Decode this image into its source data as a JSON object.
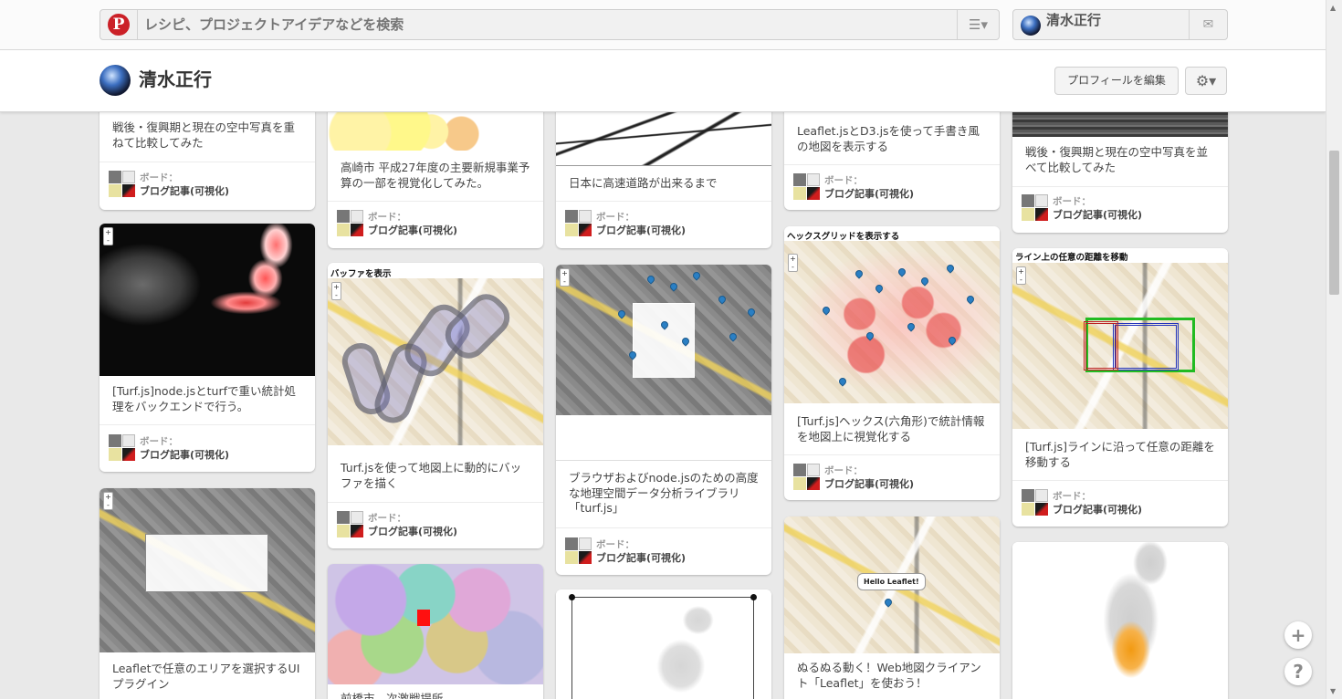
{
  "search": {
    "placeholder": "レシピ、プロジェクトアイデアなどを検索"
  },
  "user": {
    "name": "清水正行"
  },
  "profile": {
    "name": "清水正行",
    "edit_label": "プロフィールを編集"
  },
  "board": {
    "label": "ボード：",
    "name": "ブログ記事(可視化)"
  },
  "pins": {
    "c1p1": {
      "desc": "戦後・復興期と現在の空中写真を重ねて比較してみた"
    },
    "c1p2": {
      "desc": "[Turf.js]node.jsとturfで重い統計処理をバックエンドで行う。"
    },
    "c1p3": {
      "desc": "Leafletで任意のエリアを選択するUIプラグイン"
    },
    "c2p1": {
      "desc": "高崎市 平成27年度の主要新規事業予算の一部を視覚化してみた。"
    },
    "c2p2": {
      "label": "バッファを表示",
      "desc": "Turf.jsを使って地図上に動的にバッファを描く"
    },
    "c2p3": {
      "desc": "前橋市　次激戦提所"
    },
    "c3p1": {
      "desc": "日本に高速道路が出来るまで"
    },
    "c3p2": {
      "desc": "ブラウザおよびnode.jsのための高度な地理空間データ分析ライブラリ「turf.js」"
    },
    "c4p1": {
      "desc": "Leaflet.jsとD3.jsを使って手書き風の地図を表示する"
    },
    "c4p2": {
      "label": "ヘックスグリッドを表示する",
      "desc": "[Turf.js]ヘックス(六角形)で統計情報を地図上に視覚化する"
    },
    "c4p3": {
      "desc": "ぬるぬる動く！Web地図クライアント「Leaflet」を使おう！",
      "popup": "Hello Leaflet!"
    },
    "c5p1": {
      "desc": "戦後・復興期と現在の空中写真を並べて比較してみた"
    },
    "c5p2": {
      "label": "ライン上の任意の距離を移動",
      "desc": "[Turf.js]ラインに沿って任意の距離を移動する"
    }
  },
  "icons": {
    "logo": "pinterest-logo",
    "menu": "hamburger-icon",
    "notify": "message-icon",
    "gear": "gear-icon",
    "add": "plus-icon",
    "help": "help-icon"
  },
  "colors": {
    "brand": "#cb2027",
    "accent_map_marker": "#2a7fc4",
    "highlight": "#f29a12"
  }
}
